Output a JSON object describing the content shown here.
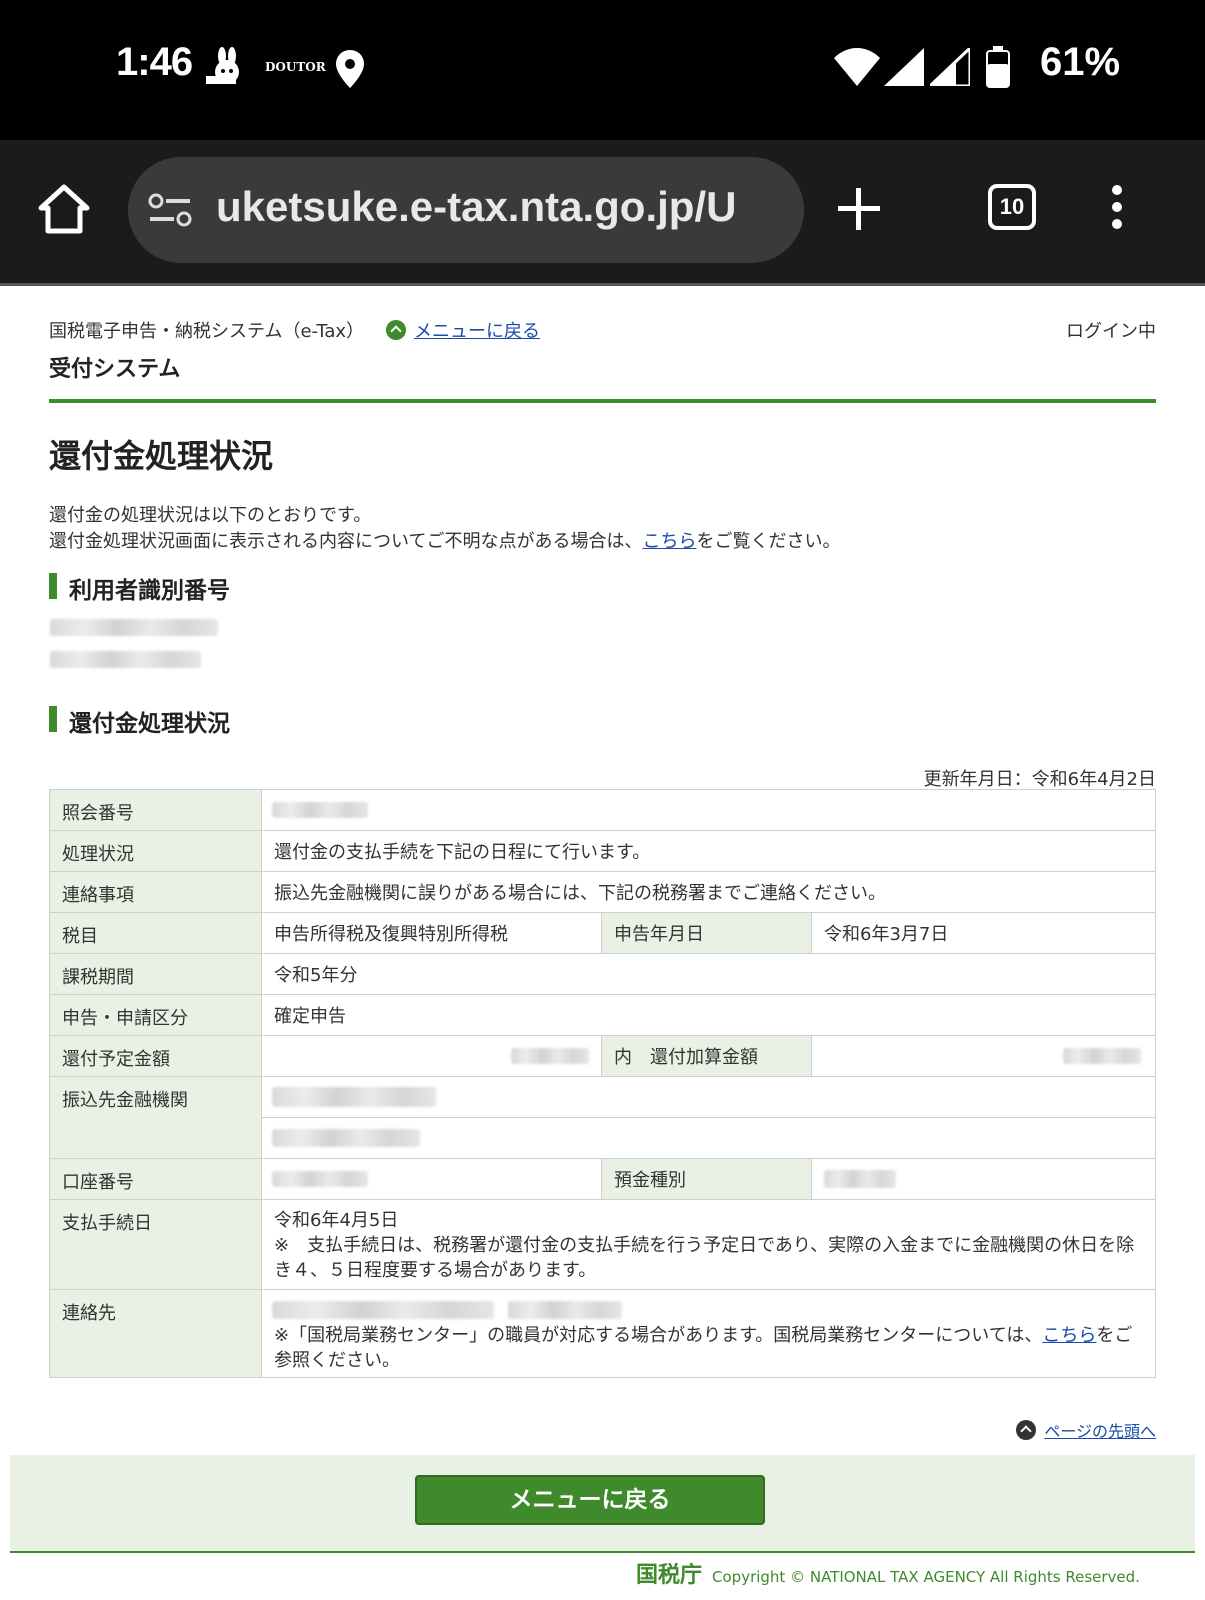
{
  "status_bar": {
    "time": "1:46",
    "notif_brand": "DOUTOR",
    "battery": "61%"
  },
  "browser": {
    "url": "uketsuke.e-tax.nta.go.jp/U",
    "tab_count": "10"
  },
  "header": {
    "system_name": "国税電子申告・納税システム（e-Tax）",
    "menu_link": "メニューに戻る",
    "login_status": "ログイン中",
    "subsystem": "受付システム"
  },
  "main": {
    "title": "還付金処理状況",
    "intro_line1": "還付金の処理状況は以下のとおりです。",
    "intro_line2_pre": "還付金処理状況画面に表示される内容についてご不明な点がある場合は、",
    "intro_link": "こちら",
    "intro_line2_post": "をご覧ください。",
    "section_user_id": "利用者識別番号",
    "section_status": "還付金処理状況",
    "updated": "更新年月日：令和6年4月2日"
  },
  "table": {
    "inquiry_no_label": "照会番号",
    "status_label": "処理状況",
    "status_value": "還付金の支払手続を下記の日程にて行います。",
    "notice_label": "連絡事項",
    "notice_value": "振込先金融機関に誤りがある場合には、下記の税務署までご連絡ください。",
    "tax_item_label": "税目",
    "tax_item_value": "申告所得税及復興特別所得税",
    "filing_date_label": "申告年月日",
    "filing_date_value": "令和6年3月7日",
    "tax_period_label": "課税期間",
    "tax_period_value": "令和5年分",
    "filing_type_label": "申告・申請区分",
    "filing_type_value": "確定申告",
    "refund_amount_label": "還付予定金額",
    "refund_addition_label": "内　還付加算金額",
    "bank_label": "振込先金融機関",
    "account_no_label": "口座番号",
    "deposit_type_label": "預金種別",
    "payment_date_label": "支払手続日",
    "payment_date_value": "令和6年4月5日",
    "payment_note": "※　支払手続日は、税務署が還付金の支払手続を行う予定日であり、実際の入金までに金融機関の休日を除き４、５日程度要する場合があります。",
    "contact_label": "連絡先",
    "contact_note_pre": "※「国税局業務センター」の職員が対応する場合があります。国税局業務センターについては、",
    "contact_link": "こちら",
    "contact_note_post": "をご参照ください。"
  },
  "footer": {
    "page_top": "ページの先頭へ",
    "menu_button": "メニューに戻る",
    "logo": "国税庁",
    "copyright": "Copyright © NATIONAL TAX AGENCY All Rights Reserved."
  }
}
